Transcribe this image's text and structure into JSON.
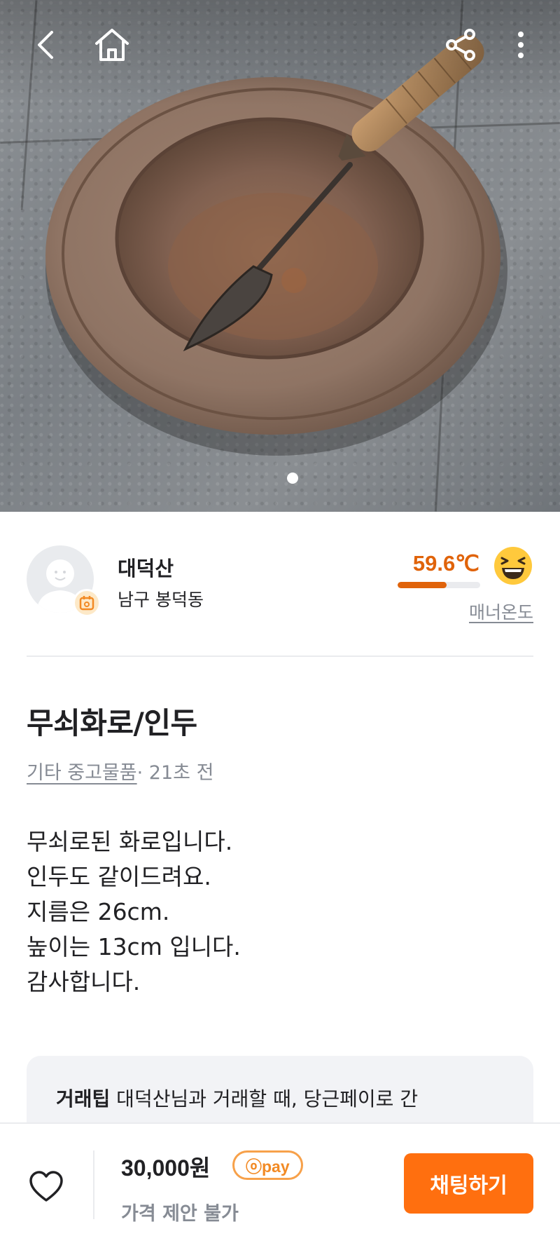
{
  "seller": {
    "name": "대덕산",
    "location": "남구 봉덕동",
    "temperature": "59.6℃",
    "temperature_level": 0.596,
    "manner_label": "매너온도"
  },
  "item": {
    "title": "무쇠화로/인두",
    "category": "기타 중고물품",
    "time_ago": "· 21초 전",
    "description": [
      "무쇠로된 화로입니다.",
      "인두도 같이드려요.",
      "지름은 26cm.",
      "높이는 13cm 입니다.",
      "감사합니다."
    ]
  },
  "tip": {
    "label": "거래팁",
    "text": " 대덕산님과 거래할 때, 당근페이로 간"
  },
  "bottom": {
    "price": "30,000원",
    "pay_badge": "ⓞpay",
    "negotiation": "가격 제안 불가",
    "chat_button": "채팅하기"
  },
  "photo": {
    "page_count": 1,
    "current_page": 1
  },
  "colors": {
    "accent": "#ff6f0f",
    "temperature": "#e0630a",
    "muted": "#868b94"
  },
  "icons": [
    "back-icon",
    "home-icon",
    "share-icon",
    "more-icon",
    "heart-icon",
    "calendar-badge-icon",
    "laughing-emoji-icon"
  ]
}
